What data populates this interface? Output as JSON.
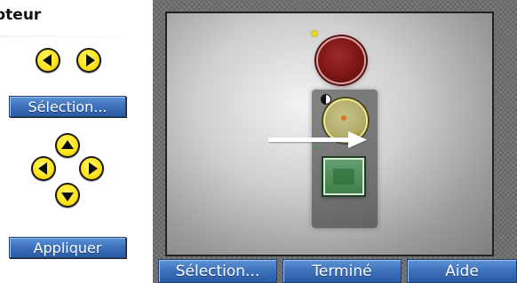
{
  "panel": {
    "title": "pteur",
    "select_label": "Sélection...",
    "apply_label": "Appliquer"
  },
  "viewer": {
    "icons": [
      "sun-icon",
      "half-contrast-icon",
      "resize-icon",
      "plus-icon",
      "pointer-arrow"
    ],
    "colors": {
      "red_light": "#7d1515",
      "dial": "#b3ac6b",
      "green_box": "#4f8b59",
      "frame": "#6d6d6d"
    }
  },
  "toolbar": {
    "select_label": "Sélection...",
    "done_label": "Terminé",
    "help_label": "Aide"
  }
}
